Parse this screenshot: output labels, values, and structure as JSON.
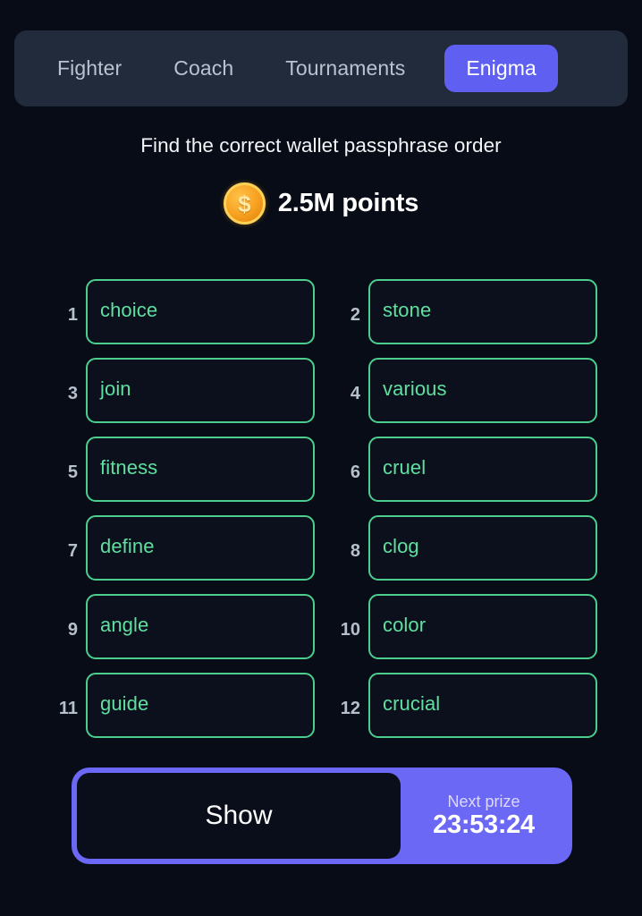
{
  "nav": {
    "tabs": [
      {
        "label": "Fighter",
        "active": false
      },
      {
        "label": "Coach",
        "active": false
      },
      {
        "label": "Tournaments",
        "active": false
      },
      {
        "label": "Enigma",
        "active": true
      }
    ],
    "active_color": "#5f5ff2",
    "bar_color": "#222b3c"
  },
  "header": {
    "subtitle": "Find the correct wallet passphrase order",
    "points": "2.5M points",
    "coin_icon": "coin-dollar-icon",
    "coin_color": "#f7a221"
  },
  "puzzle": {
    "accent_color": "#4bcd8e",
    "text_color": "#5fe0a0",
    "words": [
      {
        "num": "1",
        "word": "choice"
      },
      {
        "num": "2",
        "word": "stone"
      },
      {
        "num": "3",
        "word": "join"
      },
      {
        "num": "4",
        "word": "various"
      },
      {
        "num": "5",
        "word": "fitness"
      },
      {
        "num": "6",
        "word": "cruel"
      },
      {
        "num": "7",
        "word": "define"
      },
      {
        "num": "8",
        "word": "clog"
      },
      {
        "num": "9",
        "word": "angle"
      },
      {
        "num": "10",
        "word": "color"
      },
      {
        "num": "11",
        "word": "guide"
      },
      {
        "num": "12",
        "word": "crucial"
      }
    ]
  },
  "footer": {
    "show_label": "Show",
    "prize_label": "Next prize",
    "prize_timer": "23:53:24",
    "bar_color": "#6a68f5"
  }
}
